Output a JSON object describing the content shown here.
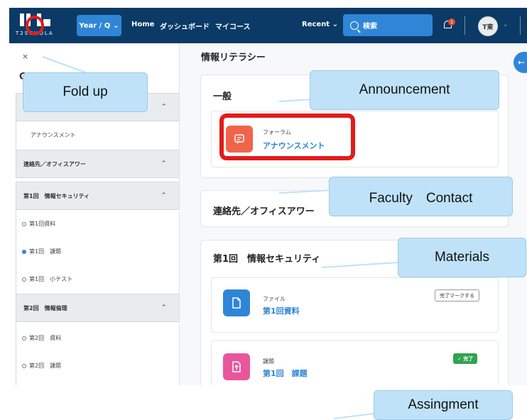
{
  "navbar": {
    "logo_text": "T2SCHOLA",
    "year_q_label": "Year / Q",
    "links": [
      "Home",
      "ダッシュボード",
      "マイコース"
    ],
    "recent_label": "Recent",
    "search_placeholder": "検索",
    "notification_count": "1",
    "avatar_initials": "T東"
  },
  "sidebar": {
    "close_label": "×",
    "partial_heading": "C",
    "sections": [
      {
        "title": "",
        "items": [
          {
            "label": "アナウンスメント",
            "state": "none"
          }
        ]
      },
      {
        "title": "連絡先／オフィスアワー",
        "items": []
      },
      {
        "title": "第1回　情報セキュリティ",
        "items": [
          {
            "label": "第1回資料",
            "state": "open"
          },
          {
            "label": "第1回　課題",
            "state": "current"
          },
          {
            "label": "第1回　小テスト",
            "state": "open"
          }
        ]
      },
      {
        "title": "第2回　情報倫理",
        "items": [
          {
            "label": "第2回　資料",
            "state": "open"
          },
          {
            "label": "第2回　課題",
            "state": "open"
          }
        ]
      }
    ]
  },
  "main": {
    "course_title": "情報リテラシー",
    "general": {
      "title": "一般",
      "activity": {
        "type": "フォーラム",
        "name": "アナウンスメント",
        "icon": "forum-icon",
        "color": "#f0654a"
      }
    },
    "contact": {
      "title": "連絡先／オフィスアワー"
    },
    "week1": {
      "title": "第1回　情報セキュリティ",
      "activities": [
        {
          "type": "ファイル",
          "name": "第1回資料",
          "icon": "file-icon",
          "color": "#2f86d6",
          "button": "完了マークする"
        },
        {
          "type": "課題",
          "name": "第1回　課題",
          "icon": "assignment-icon",
          "color": "#e8579b",
          "button": "✓ 完了"
        }
      ]
    }
  },
  "annotations": {
    "fold_up": "Fold up",
    "announcement": "Announcement",
    "faculty_contact": "Faculty　Contact",
    "materials": "Materials",
    "assignment": "Assingment"
  },
  "colors": {
    "navbar": "#0b3a66",
    "accent": "#2f86d6",
    "callout": "#bfe2f8",
    "highlight": "#e31b1b",
    "done": "#2ea44f"
  }
}
